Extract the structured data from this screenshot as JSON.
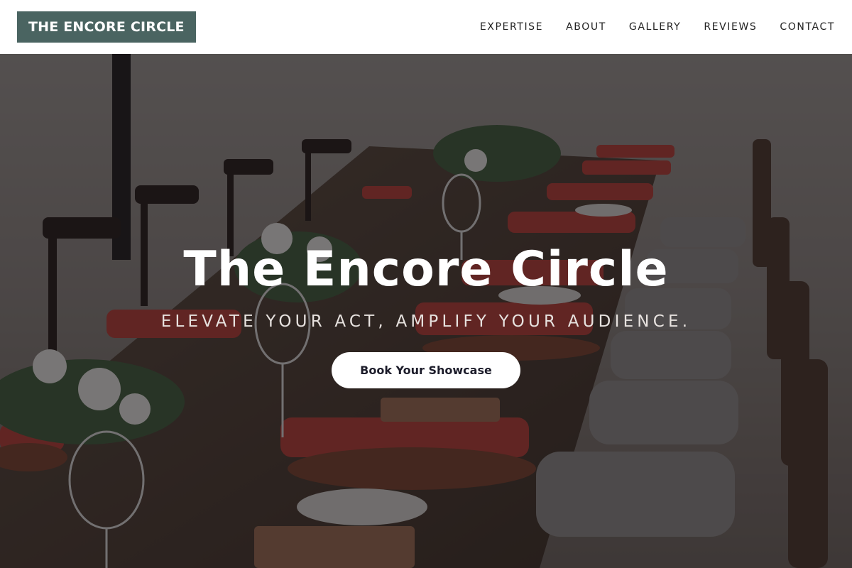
{
  "header": {
    "logo_text": "THE ENCORE CIRCLE",
    "nav": [
      {
        "label": "EXPERTISE"
      },
      {
        "label": "ABOUT"
      },
      {
        "label": "GALLERY"
      },
      {
        "label": "REVIEWS"
      },
      {
        "label": "CONTACT"
      }
    ]
  },
  "hero": {
    "title": "The Encore Circle",
    "subtitle": "ELEVATE YOUR ACT, AMPLIFY YOUR AUDIENCE.",
    "cta_label": "Book Your Showcase",
    "background_image": "banquet table with red napkins and wooden chairs"
  },
  "colors": {
    "logo_bg": "#4a6461",
    "header_bg": "#ffffff",
    "cta_bg": "#ffffff",
    "cta_text": "#1c1c2a"
  }
}
